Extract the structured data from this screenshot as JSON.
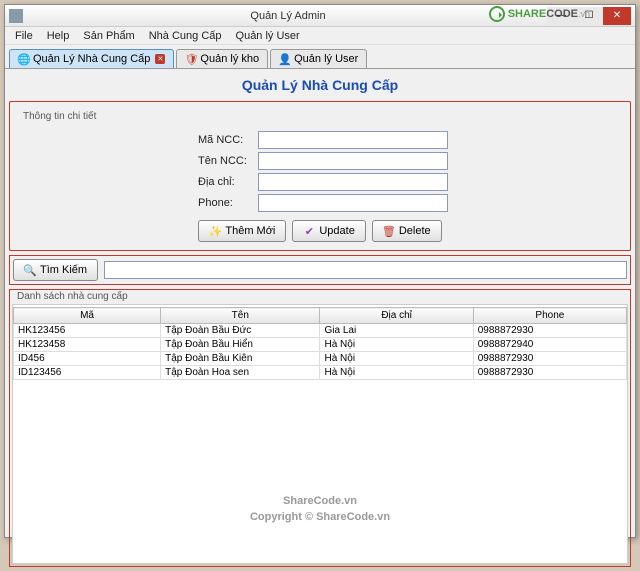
{
  "titlebar": {
    "title": "Quản Lý Admin"
  },
  "menu": {
    "file": "File",
    "help": "Help",
    "sanpham": "Sản Phẩm",
    "ncc": "Nhà Cung Cấp",
    "user": "Quản lý User"
  },
  "tabs": {
    "t1": "Quản Lý Nhà Cung Cấp",
    "t2": "Quản lý kho",
    "t3": "Quản lý User"
  },
  "page_title": "Quản Lý Nhà Cung Cấp",
  "fieldset1_title": "Thông tin chi tiết",
  "labels": {
    "ma": "Mã NCC:",
    "ten": "Tên NCC:",
    "diachi": "Địa chỉ:",
    "phone": "Phone:"
  },
  "form": {
    "ma": "",
    "ten": "",
    "diachi": "",
    "phone": ""
  },
  "buttons": {
    "them": "Thêm Mới",
    "update": "Update",
    "delete": "Delete",
    "timkiem": "Tìm Kiếm"
  },
  "search_value": "",
  "fieldset2_title": "Danh sách nhà cung cấp",
  "cols": {
    "ma": "Mã",
    "ten": "Tên",
    "diachi": "Địa chỉ",
    "phone": "Phone"
  },
  "rows": [
    {
      "ma": "HK123456",
      "ten": "Tập Đoàn Bầu Đức",
      "diachi": "Gia Lai",
      "phone": "0988872930"
    },
    {
      "ma": "HK123458",
      "ten": "Tập Đoàn Bầu Hiển",
      "diachi": "Hà Nội",
      "phone": "0988872940"
    },
    {
      "ma": "ID456",
      "ten": "Tập Đoàn Bầu Kiên",
      "diachi": "Hà Nội",
      "phone": "0988872930"
    },
    {
      "ma": "ID123456",
      "ten": "Tập Đoàn Hoa sen",
      "diachi": "Hà Nội",
      "phone": "0988872930"
    }
  ],
  "watermark": {
    "l1": "ShareCode.vn",
    "l2": "Copyright © ShareCode.vn"
  },
  "logo": {
    "p1": "SHARE",
    "p2": "CODE",
    "p3": ".vn"
  }
}
